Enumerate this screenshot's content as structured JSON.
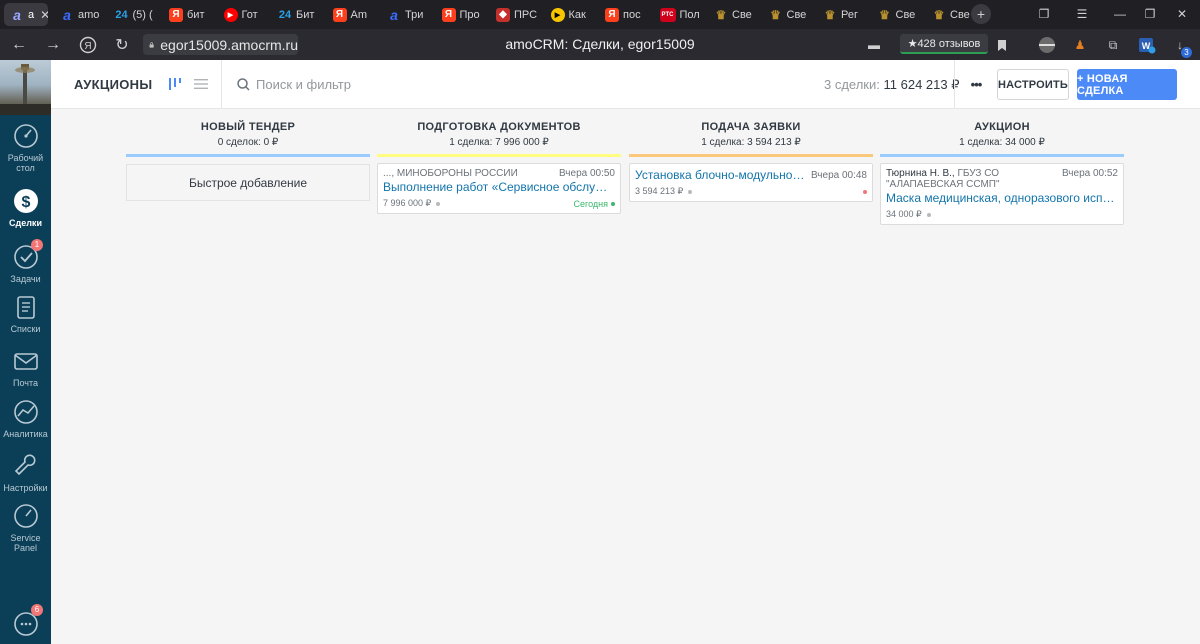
{
  "browser": {
    "tabs": [
      {
        "label": "a",
        "icon": "amocrm-icon",
        "color": "#7f8cff",
        "glyph": "a",
        "active": true
      },
      {
        "label": "amo",
        "icon": "amocrm-icon",
        "color": "#3d6bff",
        "glyph": "a"
      },
      {
        "label": "(5) (",
        "icon": "bitrix24-icon",
        "color": "#2aa0e6",
        "glyph": "24"
      },
      {
        "label": "бит",
        "icon": "yandex-icon",
        "color": "#fc3f1d",
        "glyph": "Я"
      },
      {
        "label": "Гот",
        "icon": "youtube-icon",
        "color": "#ff0000",
        "glyph": "▶"
      },
      {
        "label": "Бит",
        "icon": "bitrix24-icon",
        "color": "#2aa0e6",
        "glyph": "24"
      },
      {
        "label": "Am",
        "icon": "yandex-icon",
        "color": "#fc3f1d",
        "glyph": "Я"
      },
      {
        "label": "Три",
        "icon": "amocrm-icon",
        "color": "#3d6bff",
        "glyph": "a"
      },
      {
        "label": "Про",
        "icon": "yandex-icon",
        "color": "#fc3f1d",
        "glyph": "Я"
      },
      {
        "label": "ПРС",
        "icon": "emblem-icon",
        "color": "#c4302b",
        "glyph": "◆"
      },
      {
        "label": "Как",
        "icon": "play-icon",
        "color": "#f6c500",
        "glyph": "▶"
      },
      {
        "label": "пос",
        "icon": "yandex-icon",
        "color": "#fc3f1d",
        "glyph": "Я"
      },
      {
        "label": "Пол",
        "icon": "rts-icon",
        "color": "#d0021b",
        "glyph": "РТС"
      },
      {
        "label": "Све",
        "icon": "eagle-icon",
        "color": "#b8902e",
        "glyph": "♛"
      },
      {
        "label": "Све",
        "icon": "eagle-icon",
        "color": "#b8902e",
        "glyph": "♛"
      },
      {
        "label": "Рег",
        "icon": "eagle-icon",
        "color": "#b8902e",
        "glyph": "♛"
      },
      {
        "label": "Све",
        "icon": "eagle-icon",
        "color": "#b8902e",
        "glyph": "♛"
      },
      {
        "label": "Све",
        "icon": "eagle-icon",
        "color": "#b8902e",
        "glyph": "♛"
      }
    ],
    "url": "egor15009.amocrm.ru",
    "page_title": "amoCRM: Сделки, egor15009",
    "reviews_label": "★428 отзывов",
    "downloads_count": "3"
  },
  "sidebar": {
    "items": [
      {
        "label": "Рабочий стол",
        "icon": "dashboard-icon"
      },
      {
        "label": "Сделки",
        "icon": "deals-icon",
        "active": true
      },
      {
        "label": "Задачи",
        "icon": "tasks-icon",
        "badge": "1"
      },
      {
        "label": "Списки",
        "icon": "lists-icon"
      },
      {
        "label": "Почта",
        "icon": "mail-icon"
      },
      {
        "label": "Аналитика",
        "icon": "analytics-icon"
      },
      {
        "label": "Настройки",
        "icon": "settings-icon"
      },
      {
        "label": "Service Panel",
        "icon": "service-panel-icon"
      }
    ],
    "chat_badge": "6"
  },
  "header": {
    "title": "АУКЦИОНЫ",
    "search_placeholder": "Поиск и фильтр",
    "summary_count": "3 сделки:",
    "summary_total": "11 624 213 ₽",
    "more": "•••",
    "settings_label": "НАСТРОИТЬ",
    "new_deal_label": "+ НОВАЯ СДЕЛКА"
  },
  "columns": [
    {
      "title": "НОВЫЙ ТЕНДЕР",
      "subtitle": "0 сделок: 0 ₽",
      "color": "#99ccfd",
      "quick_add": "Быстрое добавление",
      "cards": []
    },
    {
      "title": "ПОДГОТОВКА ДОКУМЕНТОВ",
      "subtitle": "1 сделка: 7 996 000 ₽",
      "color": "#fffd7f",
      "cards": [
        {
          "company": "..., МИНОБОРОНЫ РОССИИ",
          "time": "Вчера 00:50",
          "name": "Выполнение работ «Сервисное обслуживание...",
          "price": "7 996 000 ₽",
          "status": "Сегодня",
          "status_color": "#3ab86c"
        }
      ]
    },
    {
      "title": "ПОДАЧА ЗАЯВКИ",
      "subtitle": "1 сделка: 3 594 213 ₽",
      "color": "#fbc97c",
      "cards": [
        {
          "company": "",
          "time": "Вчера 00:48",
          "name": "Установка блочно-модульной ко...",
          "price": "3 594 213 ₽",
          "status": "",
          "status_color": "#f37575"
        }
      ]
    },
    {
      "title": "АУКЦИОН",
      "subtitle": "1 сделка: 34 000 ₽",
      "color": "#99ccfd",
      "cards": [
        {
          "contact": "Тюрнина Н. В.,",
          "company": "ГБУЗ СО \"АЛАПАЕВСКАЯ ССМП\"",
          "time": "Вчера 00:52",
          "name": "Маска медицинская, одноразового использ...",
          "price": "34 000 ₽",
          "status": ""
        }
      ]
    }
  ]
}
